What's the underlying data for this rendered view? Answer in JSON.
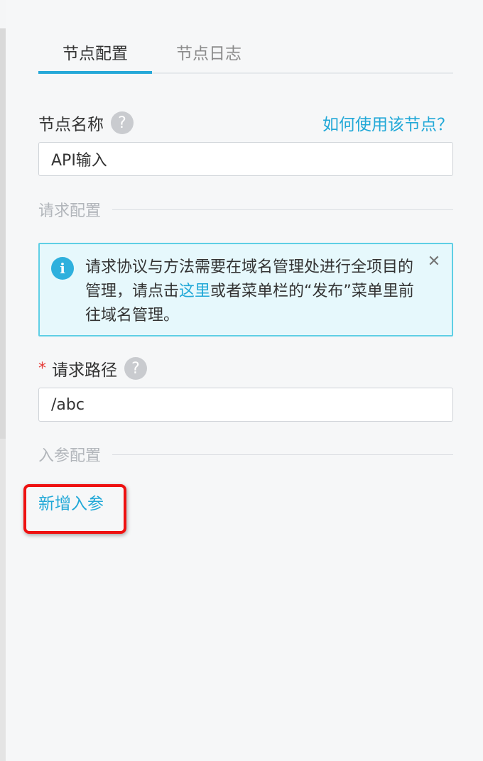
{
  "tabs": [
    {
      "label": "节点配置",
      "active": true
    },
    {
      "label": "节点日志",
      "active": false
    }
  ],
  "node_name": {
    "label": "节点名称",
    "help_glyph": "?",
    "help_link": "如何使用该节点？",
    "value": "API输入"
  },
  "request_section": {
    "title": "请求配置"
  },
  "notice": {
    "text_before": "请求协议与方法需要在域名管理处进行全项目的管理，请点击",
    "link": "这里",
    "text_after": "或者菜单栏的“发布”菜单里前往域名管理。",
    "icon": "info-icon",
    "close_glyph": "✕"
  },
  "request_path": {
    "required_mark": "*",
    "label": "请求路径",
    "help_glyph": "?",
    "value": "/abc"
  },
  "params_section": {
    "title": "入参配置",
    "add_label": "新增入参"
  },
  "colors": {
    "accent": "#21a8d7",
    "highlight": "#ee1111",
    "notice_bg": "#e6f8fc",
    "notice_border": "#5fcfe5"
  }
}
